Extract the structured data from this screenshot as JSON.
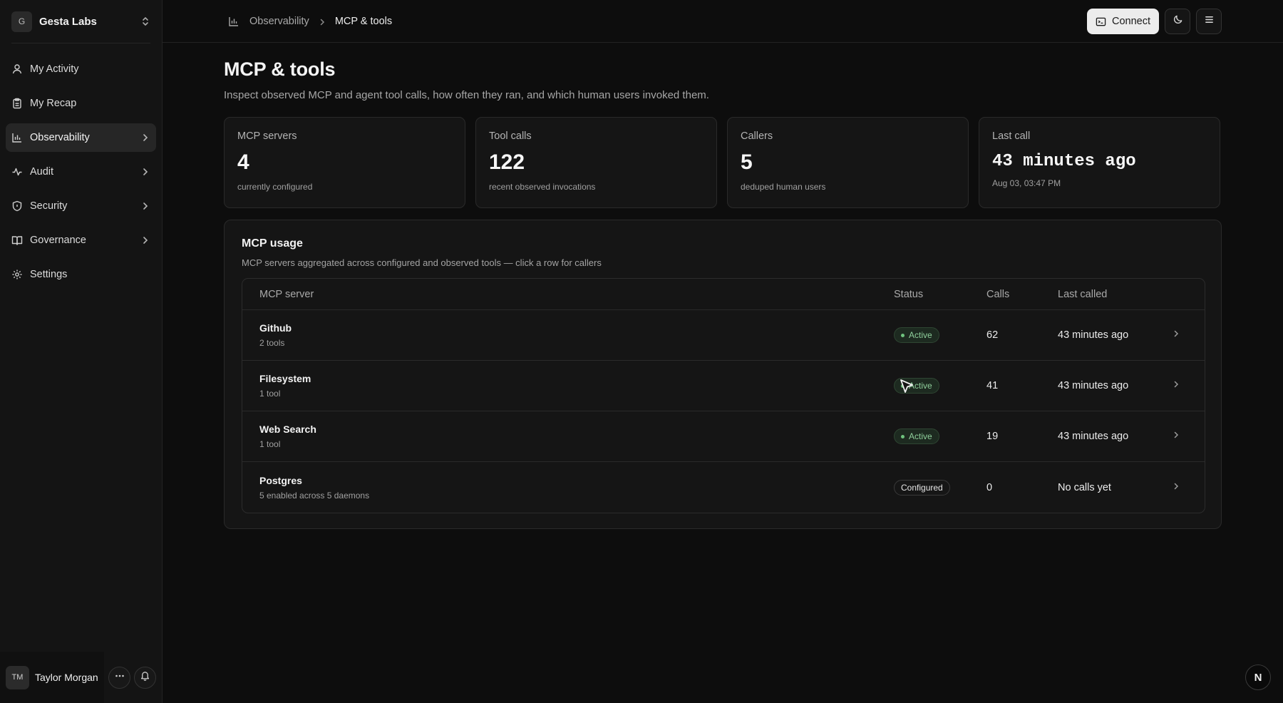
{
  "org": {
    "initial": "G",
    "name": "Gesta Labs"
  },
  "sidebar": {
    "items": [
      {
        "label": "My Activity",
        "icon": "user-icon"
      },
      {
        "label": "My Recap",
        "icon": "clipboard-icon"
      },
      {
        "label": "Observability",
        "icon": "bar-chart-icon"
      },
      {
        "label": "Audit",
        "icon": "activity-icon"
      },
      {
        "label": "Security",
        "icon": "shield-icon"
      },
      {
        "label": "Governance",
        "icon": "book-icon"
      },
      {
        "label": "Settings",
        "icon": "gear-icon"
      }
    ]
  },
  "user": {
    "initials": "TM",
    "name": "Taylor Morgan"
  },
  "breadcrumb": {
    "parent": "Observability",
    "current": "MCP & tools"
  },
  "topbar": {
    "connect_label": "Connect"
  },
  "page": {
    "title": "MCP & tools",
    "description": "Inspect observed MCP and agent tool calls, how often they ran, and which human users invoked them."
  },
  "stats": [
    {
      "label": "MCP servers",
      "value": "4",
      "sub": "currently configured"
    },
    {
      "label": "Tool calls",
      "value": "122",
      "sub": "recent observed invocations"
    },
    {
      "label": "Callers",
      "value": "5",
      "sub": "deduped human users"
    },
    {
      "label": "Last call",
      "value": "43 minutes ago",
      "sub": "Aug 03, 03:47 PM"
    }
  ],
  "usage": {
    "title": "MCP usage",
    "subtitle": "MCP servers aggregated across configured and observed tools — click a row for callers",
    "columns": {
      "server": "MCP server",
      "status": "Status",
      "calls": "Calls",
      "last": "Last called"
    },
    "rows": [
      {
        "name": "Github",
        "sub": "2 tools",
        "status": "Active",
        "calls": "62",
        "last": "43 minutes ago"
      },
      {
        "name": "Filesystem",
        "sub": "1 tool",
        "status": "Active",
        "calls": "41",
        "last": "43 minutes ago"
      },
      {
        "name": "Web Search",
        "sub": "1 tool",
        "status": "Active",
        "calls": "19",
        "last": "43 minutes ago"
      },
      {
        "name": "Postgres",
        "sub": "5 enabled across 5 daemons",
        "status": "Configured",
        "calls": "0",
        "last": "No calls yet"
      }
    ]
  },
  "corner_badge": "N",
  "colors": {
    "background": "#0d0d0d",
    "active_badge": "#8fcf9b",
    "connect_button": "#ececec"
  }
}
